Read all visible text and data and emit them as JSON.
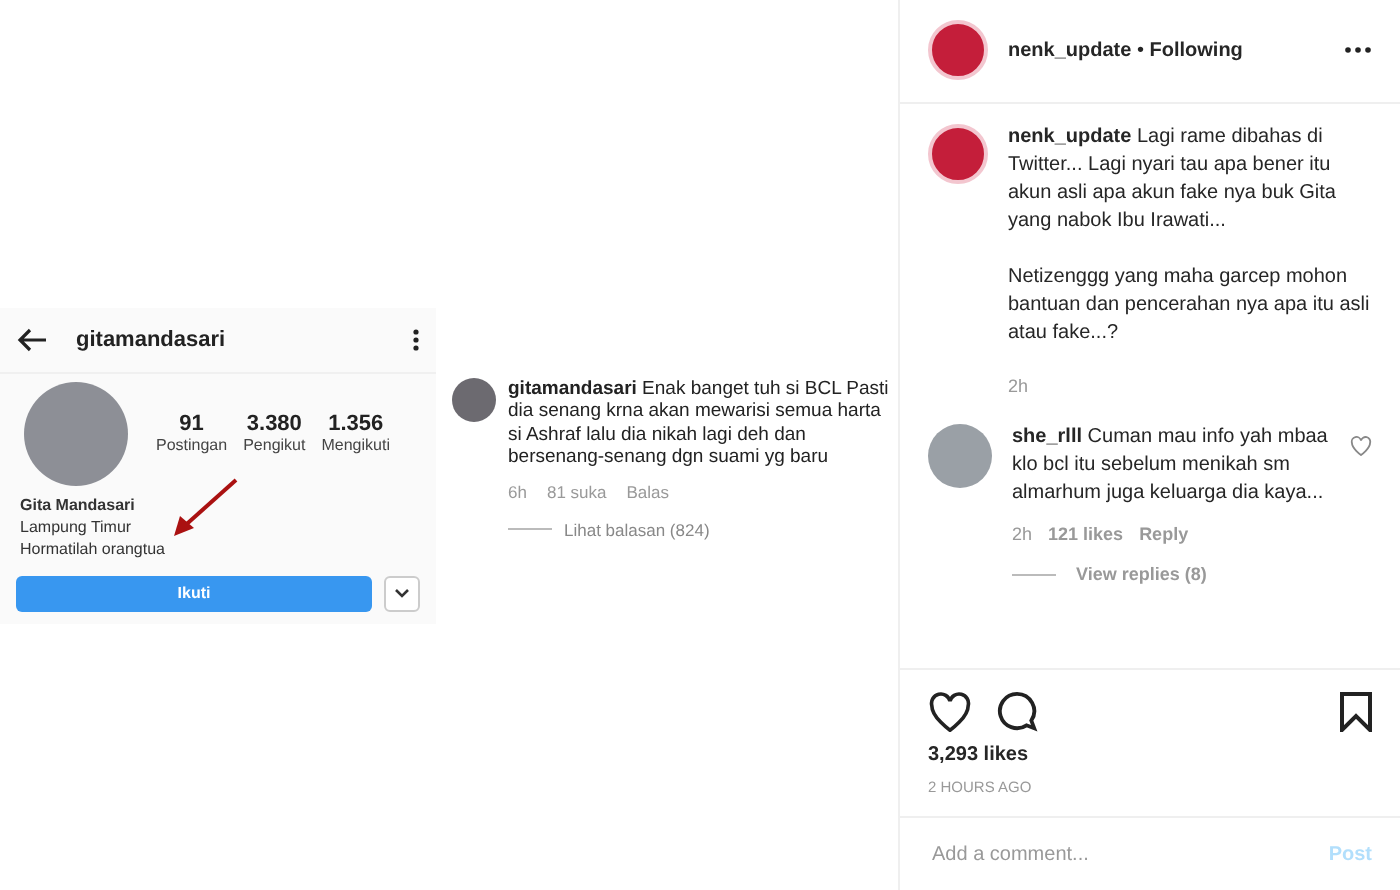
{
  "post_image": {
    "profile": {
      "username": "gitamandasari",
      "stats": [
        {
          "value": "91",
          "label": "Postingan"
        },
        {
          "value": "3.380",
          "label": "Pengikut"
        },
        {
          "value": "1.356",
          "label": "Mengikuti"
        }
      ],
      "name": "Gita Mandasari",
      "bio": [
        "Lampung Timur",
        "Hormatilah orangtua"
      ],
      "follow_button": "Ikuti"
    },
    "comment": {
      "username": "gitamandasari",
      "text": "Enak banget tuh si BCL Pasti dia senang krna akan mewarisi semua harta si Ashraf lalu dia nikah lagi deh dan bersenang-senang dgn suami yg baru",
      "time": "6h",
      "likes": "81 suka",
      "reply": "Balas",
      "view_replies": "Lihat balasan (824)"
    }
  },
  "header": {
    "username": "nenk_update",
    "separator": "•",
    "follow_state": "Following"
  },
  "caption": {
    "username": "nenk_update",
    "paragraphs": [
      "Lagi rame dibahas di Twitter... Lagi nyari tau apa bener itu akun asli apa akun fake nya buk Gita yang nabok Ibu Irawati...",
      "Netizenggg yang maha garcep mohon bantuan dan pencerahan nya apa itu asli atau fake...?"
    ],
    "time": "2h"
  },
  "comments": [
    {
      "username": "she_rlll",
      "text": "Cuman mau info yah mbaa klo bcl itu sebelum menikah sm almarhum juga keluarga dia kaya...",
      "time": "2h",
      "likes": "121 likes",
      "reply": "Reply",
      "view_replies": "View replies (8)"
    }
  ],
  "likes": "3,293 likes",
  "timestamp": "2 HOURS AGO",
  "comment_box": {
    "placeholder": "Add a comment...",
    "post_button": "Post"
  }
}
